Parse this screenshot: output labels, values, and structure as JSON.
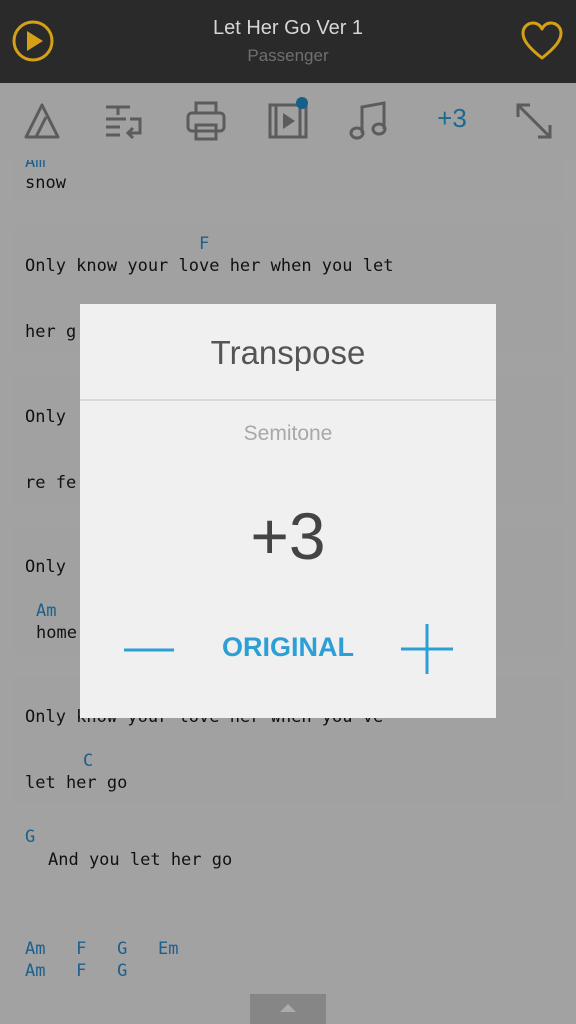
{
  "header": {
    "title": "Let Her Go Ver 1",
    "artist": "Passenger",
    "play_icon": "play-circle-icon",
    "favorite_icon": "heart-outline-icon",
    "accent_color": "#d4a017"
  },
  "toolbar": {
    "icons": [
      "capo-icon",
      "text-wrap-icon",
      "print-icon",
      "video-icon",
      "music-note-icon",
      "expand-icon"
    ],
    "transpose_value": "+3",
    "accent_color": "#2b9fd6"
  },
  "song": {
    "blocks": [
      {
        "chord": "Am",
        "lyric": "snow"
      },
      {
        "chord": "F",
        "lyric": "Only know your love her when you let"
      },
      {
        "lyric": "her g"
      },
      {
        "lyric": "Only"
      },
      {
        "lyric": "re fe"
      },
      {
        "lyric": "Only"
      },
      {
        "chord": "Am",
        "lyric": "home"
      },
      {
        "lyric": "Only know your love her when you've"
      },
      {
        "chord": "C",
        "lyric": "let her go"
      }
    ],
    "chorus": {
      "chord": "G",
      "lyric": "And you let her go",
      "chord_line_1": "Am   F   G   Em",
      "chord_line_2": "Am   F   G"
    }
  },
  "dialog": {
    "title": "Transpose",
    "subtitle": "Semitone",
    "value": "+3",
    "original_label": "ORIGINAL",
    "minus_icon": "minus-icon",
    "plus_icon": "plus-icon"
  }
}
